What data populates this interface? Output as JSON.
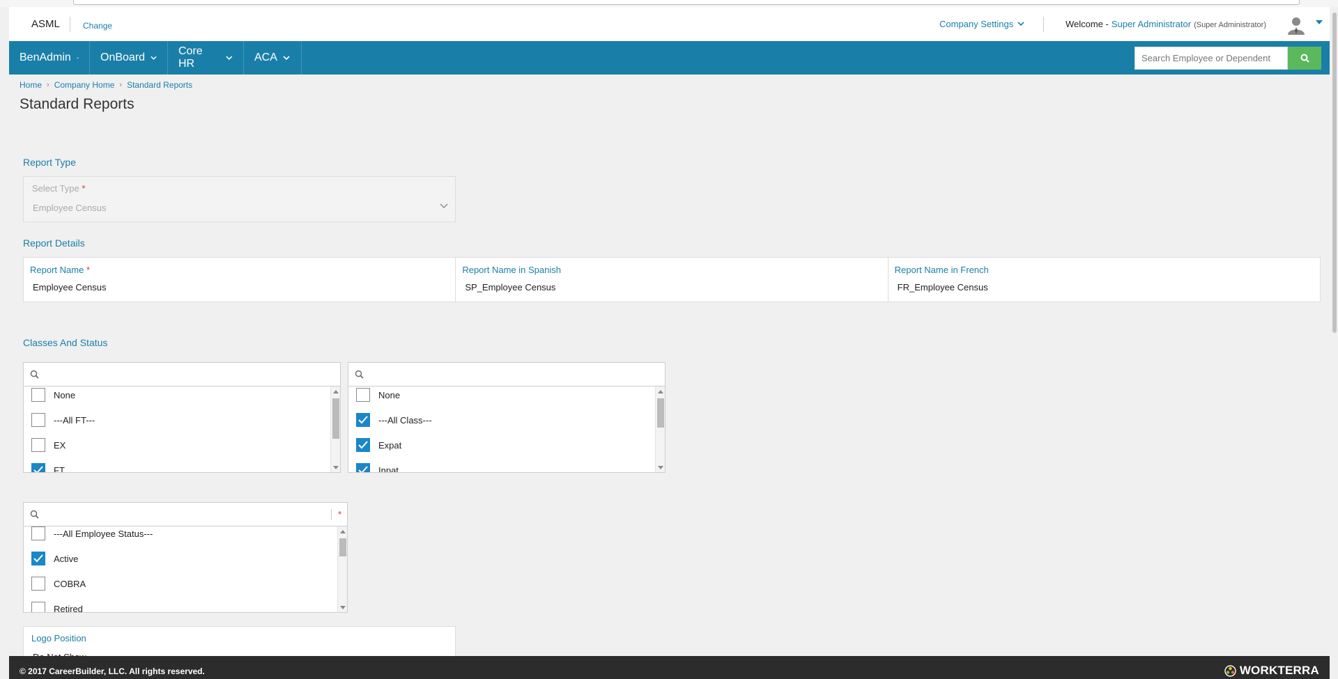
{
  "header": {
    "brand": "ASML",
    "change_label": "Change",
    "company_settings_label": "Company Settings",
    "welcome_label": "Welcome -",
    "user_name": "Super Administrator",
    "user_role": "(Super Administrator)"
  },
  "nav": {
    "items": [
      {
        "label": "BenAdmin"
      },
      {
        "label": "OnBoard"
      },
      {
        "label": "Core HR"
      },
      {
        "label": "ACA"
      }
    ],
    "search_placeholder": "Search Employee or Dependent"
  },
  "breadcrumb": [
    "Home",
    "Company Home",
    "Standard Reports"
  ],
  "page_title": "Standard Reports",
  "report_type": {
    "section_label": "Report Type",
    "field_label": "Select Type",
    "value": "Employee Census"
  },
  "report_details": {
    "section_label": "Report Details",
    "fields": [
      {
        "label": "Report Name",
        "required": "*",
        "value": "Employee Census"
      },
      {
        "label": "Report Name in Spanish",
        "value": "SP_Employee Census"
      },
      {
        "label": "Report Name in French",
        "value": "FR_Employee Census"
      }
    ]
  },
  "classes_status": {
    "section_label": "Classes And Status",
    "list1": [
      {
        "label": "None",
        "checked": false
      },
      {
        "label": "---All FT---",
        "checked": false
      },
      {
        "label": "EX",
        "checked": false
      },
      {
        "label": "FT",
        "checked": true
      }
    ],
    "list2": [
      {
        "label": "None",
        "checked": false
      },
      {
        "label": "---All Class---",
        "checked": true
      },
      {
        "label": "Expat",
        "checked": true
      },
      {
        "label": "Inpat",
        "checked": true
      }
    ],
    "list3": [
      {
        "label": "---All Employee Status---",
        "checked": false
      },
      {
        "label": "Active",
        "checked": true
      },
      {
        "label": "COBRA",
        "checked": false
      },
      {
        "label": "Retired",
        "checked": false
      }
    ],
    "required_mark": "*"
  },
  "logo_position": {
    "label": "Logo Position",
    "value": "Do Not Show"
  },
  "footer": {
    "copyright": "© 2017 CareerBuilder, LLC. All rights reserved.",
    "logo_text": "WORKTERRA"
  },
  "colors": {
    "accent": "#1a7fa8",
    "nav_bg": "#1a7fa8",
    "search_button": "#5cb85c",
    "checkbox_on": "#1a87c8",
    "footer_bg": "#2c2c2c"
  }
}
